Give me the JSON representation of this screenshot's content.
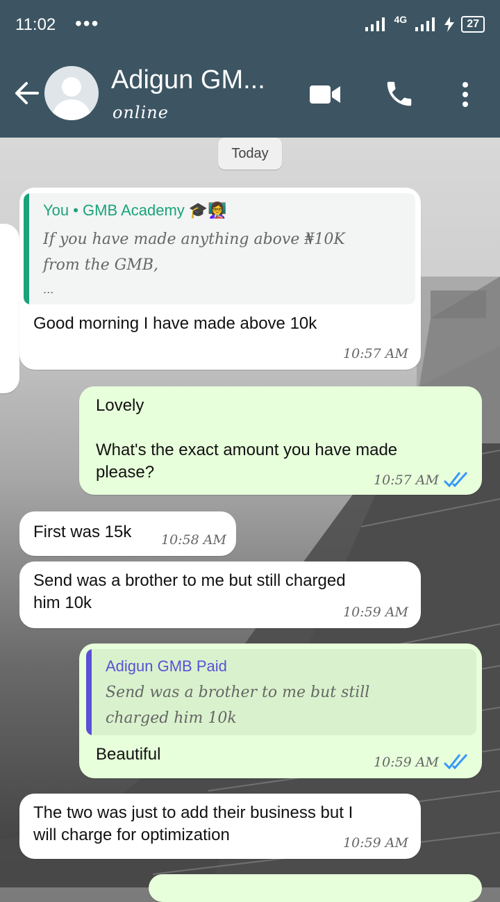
{
  "status_bar": {
    "time": "11:02",
    "dots": "•••",
    "network": "4G",
    "battery": "27"
  },
  "header": {
    "contact_name": "Adigun GM...",
    "status": "online"
  },
  "date_chip": "Today",
  "messages": [
    {
      "quote_author": "You • GMB Academy 🎓👩‍🏫",
      "quote_line1": "If you have made anything above ₦10K",
      "quote_line2": "from the GMB,",
      "quote_line3": "...",
      "text": "Good morning I have made above 10k",
      "time": "10:57 AM"
    },
    {
      "line1": "Lovely",
      "line2": "What's the exact amount you have made",
      "line3": "please?",
      "time": "10:57 AM"
    },
    {
      "text": "First was 15k",
      "time": "10:58 AM"
    },
    {
      "line1": "Send was a brother to me but still charged",
      "line2": "him 10k",
      "time": "10:59 AM"
    },
    {
      "quote_author": "Adigun GMB Paid",
      "quote_line1": "Send was a brother to me but still",
      "quote_line2": "charged him 10k",
      "text": "Beautiful",
      "time": "10:59 AM"
    },
    {
      "line1": "The two was just to add their business but I",
      "line2": "will charge for optimization",
      "time": "10:59 AM"
    }
  ],
  "colors": {
    "header": "#3d5563",
    "incoming": "#ffffff",
    "outgoing": "#e7ffdb",
    "quote_you": "#1aa37a",
    "quote_other": "#5b4fd6",
    "read_ticks": "#3497f9"
  },
  "icons": [
    "back-arrow-icon",
    "avatar-icon",
    "video-call-icon",
    "voice-call-icon",
    "more-vert-icon"
  ]
}
